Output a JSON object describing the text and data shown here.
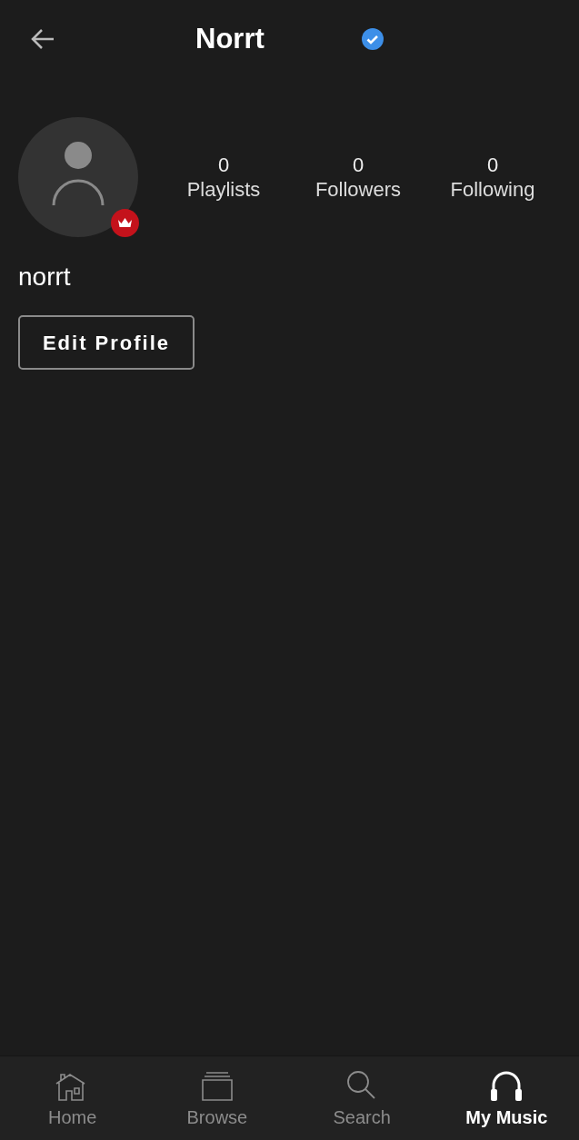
{
  "header": {
    "title": "Norrt",
    "verified": true
  },
  "profile": {
    "premium": true,
    "username": "norrt",
    "edit_button": "Edit Profile"
  },
  "stats": [
    {
      "value": "0",
      "label": "Playlists"
    },
    {
      "value": "0",
      "label": "Followers"
    },
    {
      "value": "0",
      "label": "Following"
    }
  ],
  "bottom_nav": [
    {
      "kind": "home",
      "label": "Home",
      "selected": false
    },
    {
      "kind": "browse",
      "label": "Browse",
      "selected": false
    },
    {
      "kind": "search",
      "label": "Search",
      "selected": false
    },
    {
      "kind": "music",
      "label": "My Music",
      "selected": true
    }
  ]
}
